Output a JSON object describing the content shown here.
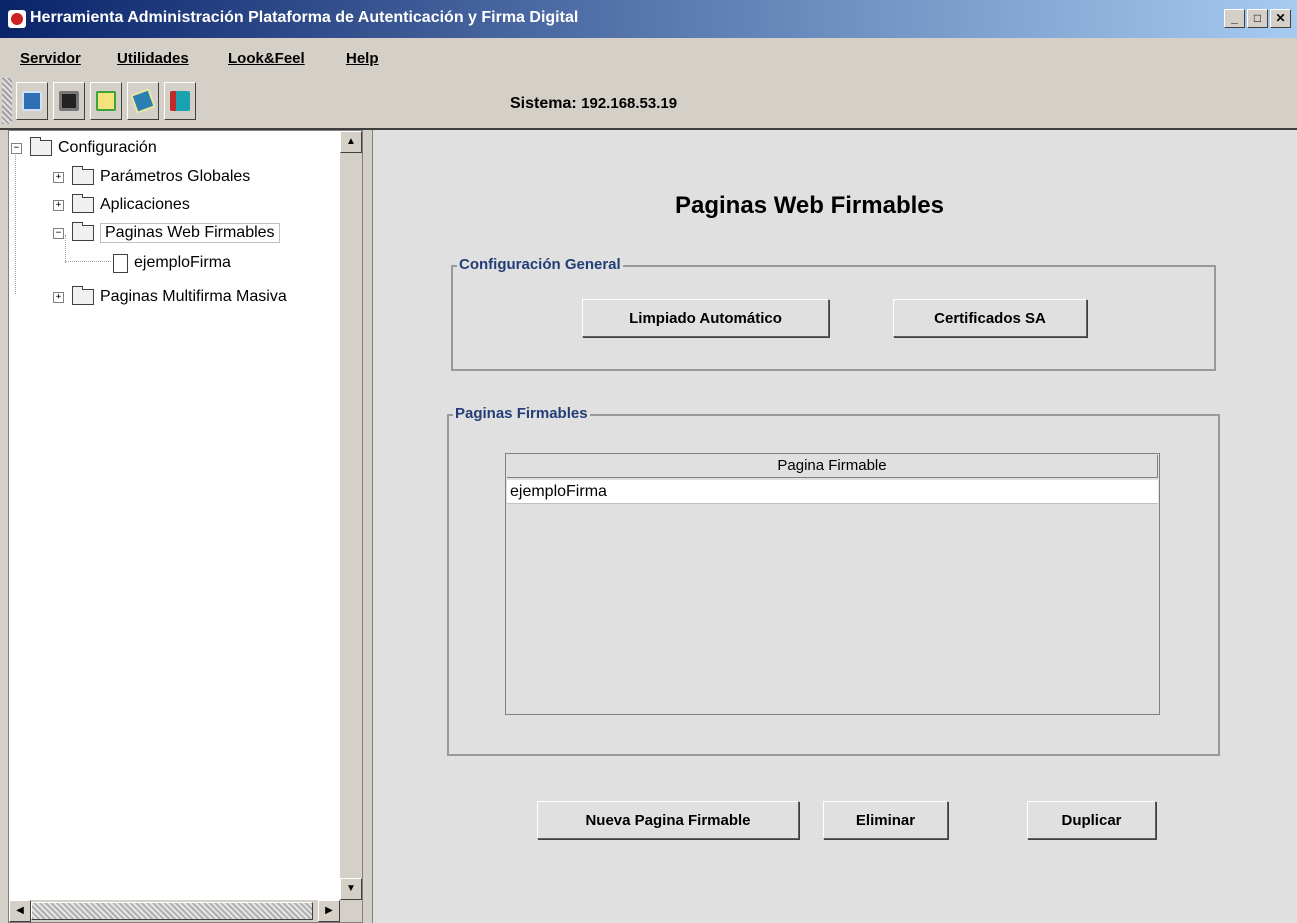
{
  "window": {
    "title": "Herramienta Administración Plataforma de Autenticación y Firma Digital",
    "controls": {
      "minimize": "_",
      "maximize": "□",
      "close": "✕"
    }
  },
  "menubar": [
    {
      "label": "Servidor"
    },
    {
      "label": "Utilidades"
    },
    {
      "label": "Look&Feel"
    },
    {
      "label": "Help"
    }
  ],
  "toolbar": {
    "buttons": [
      {
        "icon": "network-computer-icon",
        "color": "#2f6fb5"
      },
      {
        "icon": "save-disk-icon",
        "color": "#222222"
      },
      {
        "icon": "refresh-icon",
        "color": "#3aa53a"
      },
      {
        "icon": "book-icon",
        "color": "#2a7fb0"
      },
      {
        "icon": "exit-door-icon",
        "color": "#c02a2a"
      }
    ],
    "sistema_label": "Sistema:",
    "sistema_ip": "192.168.53.19"
  },
  "tree": {
    "root": "Configuración",
    "nodes": [
      {
        "label": "Parámetros Globales"
      },
      {
        "label": "Aplicaciones"
      },
      {
        "label": "Paginas Web Firmables",
        "selected": true
      },
      {
        "label": "ejemploFirma"
      },
      {
        "label": "Paginas Multifirma Masiva"
      }
    ],
    "expanders": {
      "collapse": "−",
      "expand": "+"
    }
  },
  "main": {
    "title": "Paginas Web Firmables",
    "config_group": {
      "title": "Configuración General",
      "buttons": [
        "Limpiado Automático",
        "Certificados SA"
      ]
    },
    "pages_group": {
      "title": "Paginas Firmables",
      "table": {
        "column": "Pagina Firmable",
        "rows": [
          "ejemploFirma"
        ]
      }
    },
    "actions": [
      "Nueva Pagina Firmable",
      "Eliminar",
      "Duplicar"
    ]
  }
}
